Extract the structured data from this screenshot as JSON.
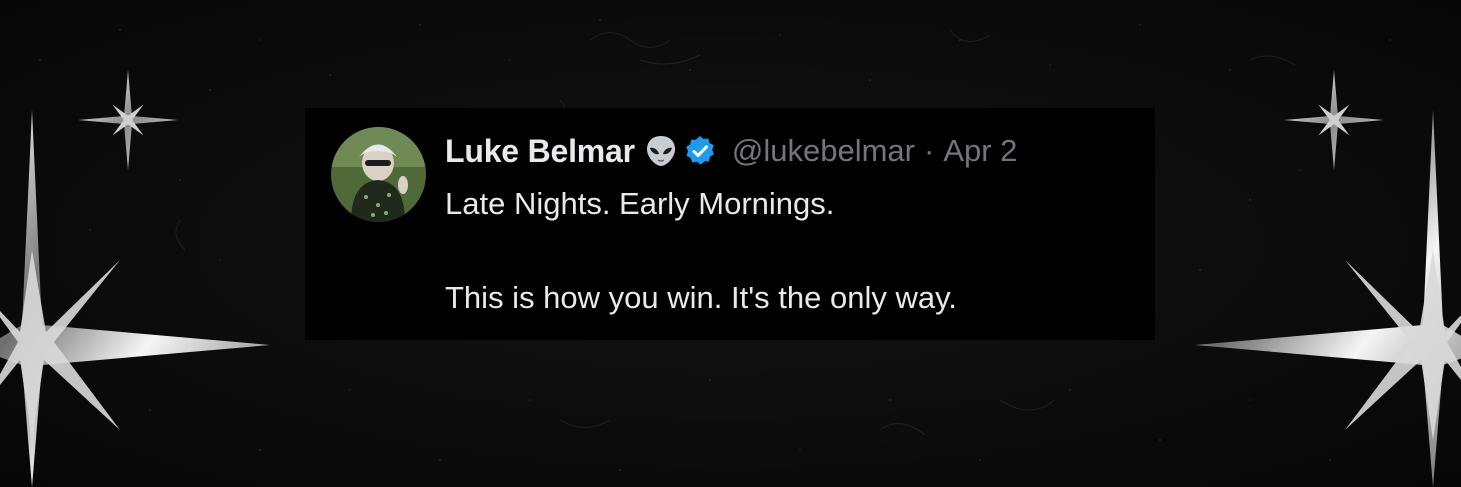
{
  "tweet": {
    "display_name": "Luke Belmar",
    "name_badge_icon": "alien-emoji-icon",
    "verified_icon": "verified-badge-icon",
    "handle": "@lukebelmar",
    "separator": "·",
    "date": "Apr 2",
    "lines": [
      "Late Nights. Early Mornings.",
      "This is how you win. It's the only way."
    ]
  },
  "colors": {
    "background": "#0b0b0b",
    "card": "#000000",
    "name_text": "#e7e9ea",
    "meta_text": "#71767b",
    "verified_blue": "#1d9bf0"
  },
  "decorations": {
    "sparkle_icon": "four-point-star-icon"
  }
}
